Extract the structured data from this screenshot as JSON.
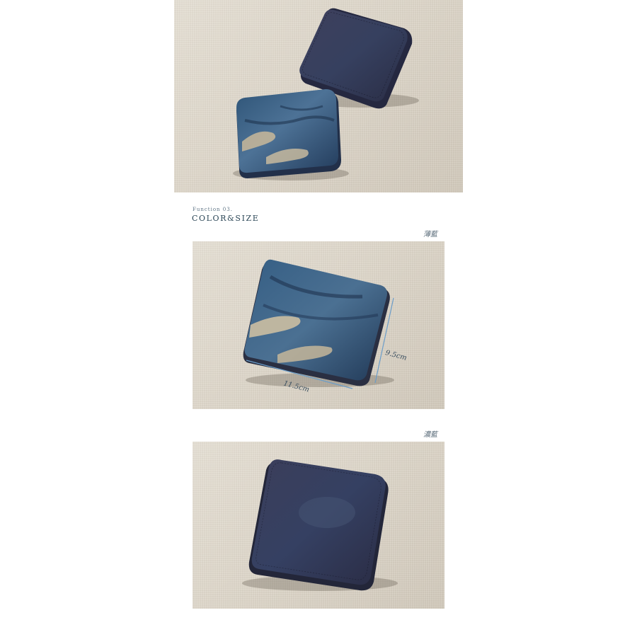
{
  "section": {
    "kicker": "Function 03.",
    "title": "COLOR&SIZE"
  },
  "colors": [
    {
      "label": "薄藍",
      "swatch": "#3d5a76"
    },
    {
      "label": "濃藍",
      "swatch": "#2e3550"
    }
  ],
  "dimensions": {
    "height": "9.5cm",
    "width": "11.5cm"
  },
  "palette": {
    "background": "#ffffff",
    "linen": "#ddd6c9",
    "text_accent": "#2b4656",
    "dimension_line": "#6b9dc9"
  }
}
